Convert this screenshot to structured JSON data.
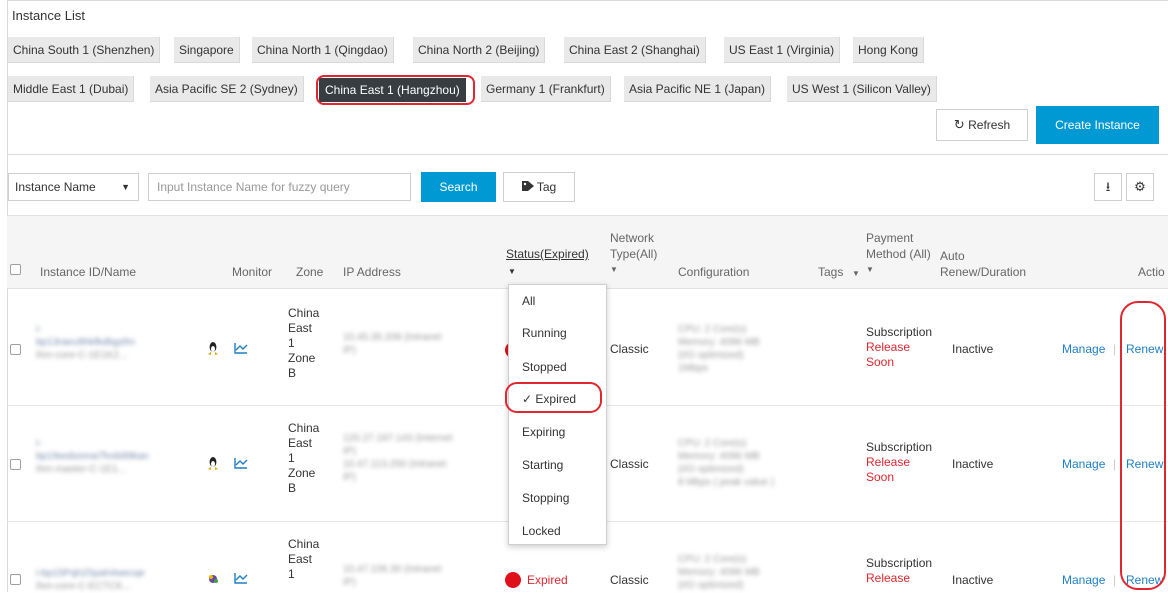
{
  "page": {
    "title": "Instance List"
  },
  "regions_row1": [
    "China South 1 (Shenzhen)",
    "Singapore",
    "China North 1 (Qingdao)",
    "China North 2 (Beijing)",
    "China East 2 (Shanghai)",
    "US East 1 (Virginia)",
    "Hong Kong"
  ],
  "regions_row2": [
    "Middle East 1 (Dubai)",
    "Asia Pacific SE 2 (Sydney)",
    "China East 1 (Hangzhou)",
    "Germany 1 (Frankfurt)",
    "Asia Pacific NE 1 (Japan)",
    "US West 1 (Silicon Valley)"
  ],
  "selected_region": "China East 1 (Hangzhou)",
  "toolbar": {
    "refresh_label": "Refresh",
    "create_label": "Create Instance"
  },
  "filter": {
    "field_select": "Instance Name",
    "search_placeholder": "Input Instance Name for fuzzy query",
    "search_label": "Search",
    "tag_label": "Tag"
  },
  "columns": {
    "id_name": "Instance ID/Name",
    "monitor": "Monitor",
    "zone": "Zone",
    "ip": "IP Address",
    "status": "Status(Expired)",
    "network_1": "Network",
    "network_2": "Type(All)",
    "configuration": "Configuration",
    "tags": "Tags",
    "payment_1": "Payment",
    "payment_2": "Method (All)",
    "auto_1": "Auto",
    "auto_2": "Renew/Duration",
    "actions": "Actio"
  },
  "status_menu": [
    "All",
    "Running",
    "Stopped",
    "Expired",
    "Expiring",
    "Starting",
    "Stopping",
    "Locked"
  ],
  "status_menu_checked": "Expired",
  "rows": [
    {
      "zone": [
        "China",
        "East",
        "1",
        "Zone",
        "B"
      ],
      "network": "Classic",
      "payment": "Subscription",
      "payment_note_1": "Release",
      "payment_note_2": "Soon",
      "auto_renew": "Inactive",
      "manage": "Manage",
      "renew": "Renew"
    },
    {
      "zone": [
        "China",
        "East",
        "1",
        "Zone",
        "B"
      ],
      "network": "Classic",
      "payment": "Subscription",
      "payment_note_1": "Release",
      "payment_note_2": "Soon",
      "auto_renew": "Inactive",
      "manage": "Manage",
      "renew": "Renew"
    },
    {
      "zone": [
        "China",
        "East",
        "1"
      ],
      "status": "Expired",
      "network": "Classic",
      "payment": "Subscription",
      "payment_note_1": "Release",
      "auto_renew": "Inactive",
      "manage": "Manage",
      "renew": "Renew"
    }
  ],
  "colors": {
    "accent": "#0099d4",
    "active_region": "#373d41",
    "danger": "#e0262f",
    "link": "#1e7fc5"
  },
  "icons": [
    "refresh-icon",
    "tag-icon",
    "export-icon",
    "gear-icon",
    "linux-icon",
    "monitor-chart-icon",
    "suse-icon",
    "check-icon"
  ]
}
